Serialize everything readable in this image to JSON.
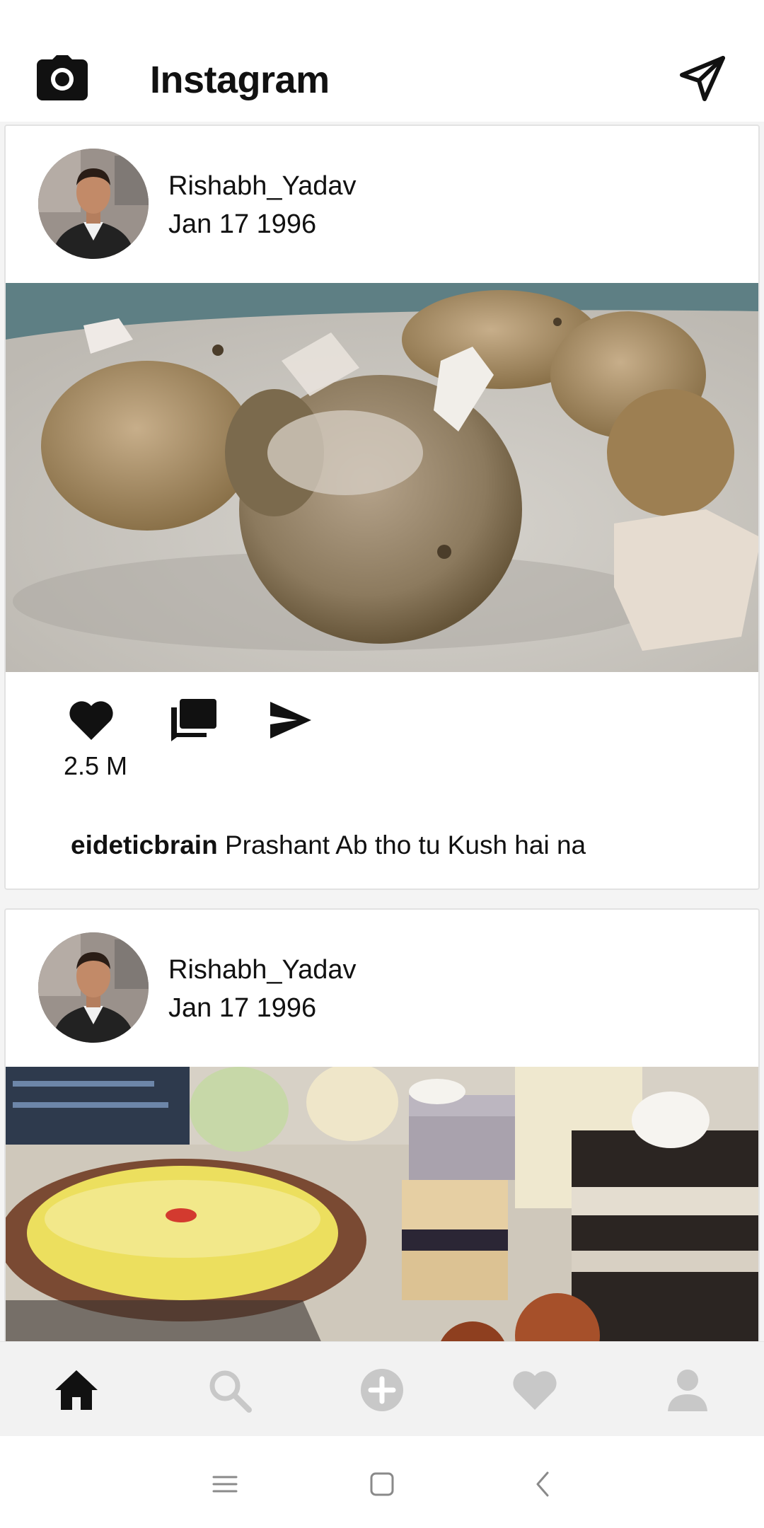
{
  "app": {
    "title": "Instagram",
    "icons": {
      "camera": "camera-icon",
      "direct": "paper-plane-icon"
    }
  },
  "feed": {
    "posts": [
      {
        "username": "Rishabh_Yadav",
        "date": "Jan 17 1996",
        "image": "fried dumplings in creamy sauce with chopped onion on a grey plate",
        "likes": "2.5 M",
        "caption_user": "eideticbrain",
        "caption_text": " Prashant Ab tho tu Kush hai na"
      },
      {
        "username": "Rishabh_Yadav",
        "date": "Jan 17 1996",
        "image": "dessert platter with custard bowl, cakes and gulab jamun"
      }
    ]
  },
  "bottom_nav": {
    "items": [
      "home-icon",
      "search-icon",
      "add-icon",
      "heart-icon",
      "profile-icon"
    ],
    "active": "home-icon"
  },
  "system_nav": {
    "items": [
      "menu-icon",
      "home-square-icon",
      "back-icon"
    ]
  },
  "colors": {
    "text": "#111111",
    "inactive_icon": "#c8c8c8",
    "nav_bg": "#f2f2f2"
  }
}
